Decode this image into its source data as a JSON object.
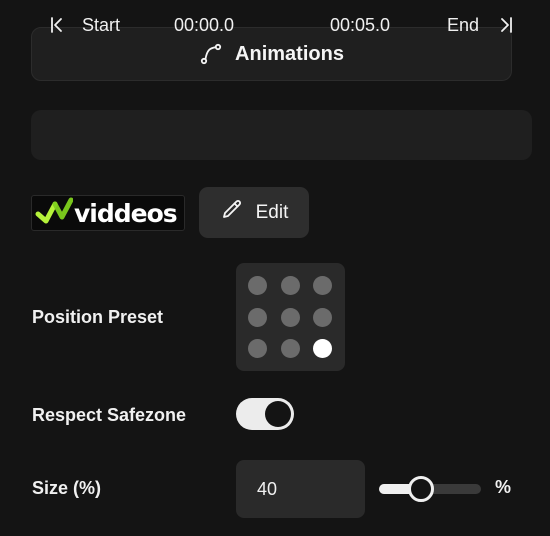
{
  "animations": {
    "label": "Animations",
    "icon": "curve-path-icon"
  },
  "timeline": {
    "start_label": "Start",
    "start_time": "00:00.0",
    "end_time": "00:05.0",
    "end_label": "End",
    "start_icon": "skip-to-start-icon",
    "end_icon": "skip-to-end-icon"
  },
  "logo": {
    "text": "viddeos",
    "accent_color": "#b5f23a"
  },
  "edit": {
    "label": "Edit",
    "icon": "pencil-icon"
  },
  "position_preset": {
    "label": "Position Preset",
    "rows": 3,
    "cols": 3,
    "selected": "bottom-right"
  },
  "safezone": {
    "label": "Respect Safezone",
    "enabled": true
  },
  "size": {
    "label": "Size (%)",
    "value": "40",
    "unit": "%",
    "slider_fraction": 0.4
  },
  "colors": {
    "background": "#141414",
    "panel": "#1f1f1f",
    "control": "#2a2a2a",
    "dot": "#6b6b6b",
    "dot_selected": "#ffffff"
  }
}
